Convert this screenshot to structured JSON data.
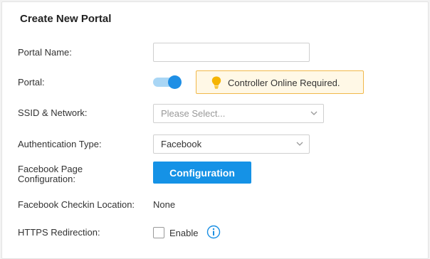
{
  "page": {
    "title": "Create New Portal"
  },
  "form": {
    "portal_name": {
      "label": "Portal Name:",
      "value": "",
      "placeholder": ""
    },
    "portal": {
      "label": "Portal:",
      "enabled": true,
      "notice": "Controller Online Required.",
      "notice_icon": "lightbulb-icon"
    },
    "ssid_network": {
      "label": "SSID & Network:",
      "placeholder": "Please Select..."
    },
    "auth_type": {
      "label": "Authentication Type:",
      "value": "Facebook"
    },
    "facebook_page": {
      "label_line1": "Facebook Page",
      "label_line2": "Configuration:",
      "button_label": "Configuration"
    },
    "checkin_location": {
      "label": "Facebook Checkin Location:",
      "value": "None"
    },
    "https_redirection": {
      "label": "HTTPS Redirection:",
      "checkbox_label": "Enable",
      "checked": false,
      "info_icon": "info-icon"
    }
  },
  "colors": {
    "accent": "#1592e6",
    "toggle_track": "#a9d6f5",
    "toggle_knob": "#1f8fe5",
    "notice_bg": "#fff8e6",
    "notice_border": "#f1b84a",
    "bulb": "#f5b400",
    "info": "#1a8fe3"
  }
}
